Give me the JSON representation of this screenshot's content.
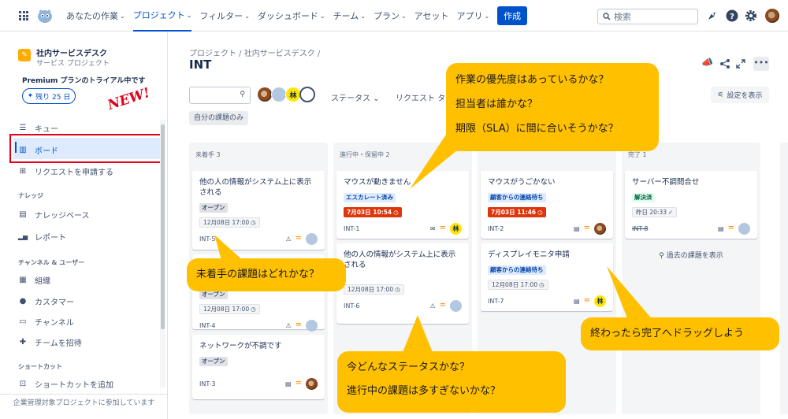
{
  "topbar": {
    "nav": [
      {
        "label": "あなたの作業",
        "chev": true,
        "active": false
      },
      {
        "label": "プロジェクト",
        "chev": true,
        "active": true
      },
      {
        "label": "フィルター",
        "chev": true,
        "active": false
      },
      {
        "label": "ダッシュボード",
        "chev": true,
        "active": false
      },
      {
        "label": "チーム",
        "chev": true,
        "active": false
      },
      {
        "label": "プラン",
        "chev": true,
        "active": false
      },
      {
        "label": "アセット",
        "chev": false,
        "active": false
      },
      {
        "label": "アプリ",
        "chev": true,
        "active": false
      }
    ],
    "create_label": "作成",
    "search_placeholder": "検索"
  },
  "sidebar": {
    "project_name": "社内サービスデスク",
    "project_type": "サービス プロジェクト",
    "premium_text": "Premium プランのトライアル中です",
    "trial_label": "残り 25 日",
    "new_label": "NEW!",
    "items_main": [
      {
        "label": "キュー",
        "icon": "queue-icon",
        "glyph": "☰"
      },
      {
        "label": "ボード",
        "icon": "board-icon",
        "glyph": "▥"
      },
      {
        "label": "リクエストを申請する",
        "icon": "request-icon",
        "glyph": "⊞"
      }
    ],
    "section_knowledge": "ナレッジ",
    "items_knowledge": [
      {
        "label": "ナレッジベース",
        "icon": "knowledge-base-icon",
        "glyph": "▤"
      },
      {
        "label": "レポート",
        "icon": "report-icon",
        "glyph": "▁▃▅"
      }
    ],
    "section_channels": "チャンネル & ユーザー",
    "items_channels": [
      {
        "label": "組織",
        "icon": "organization-icon",
        "glyph": "▦"
      },
      {
        "label": "カスタマー",
        "icon": "customers-icon",
        "glyph": "●"
      },
      {
        "label": "チャンネル",
        "icon": "channel-icon",
        "glyph": "▭"
      },
      {
        "label": "チームを招待",
        "icon": "invite-team-icon",
        "glyph": "+"
      }
    ],
    "section_shortcuts": "ショートカット",
    "add_shortcut": "ショートカットを追加",
    "footer": "企業管理対象プロジェクトに参加しています"
  },
  "header": {
    "breadcrumb": "プロジェクト  /  社内サービスデスク  /",
    "title": "INT",
    "filters": {
      "avatar_letter": "林",
      "status_label": "ステータス",
      "request_label": "リクエスト タイ",
      "my_issues_label": "自分の課題のみ",
      "settings_label": "設定を表示"
    }
  },
  "columns": [
    {
      "title": "未着手 3"
    },
    {
      "title": "進行中・保留中 2"
    },
    {
      "title": ""
    },
    {
      "title": "完了 1"
    }
  ],
  "cards": {
    "c1": {
      "title": "他の人の情報がシステム上に表示される",
      "status": "オープン",
      "due": "12月08日 17:00",
      "key": "INT-5"
    },
    "c2": {
      "status": "オープン",
      "due": "12月08日 17:00",
      "key": "INT-4"
    },
    "c3": {
      "title": "ネットワークが不調です",
      "status": "オープン",
      "key": "INT-3"
    },
    "c4": {
      "title": "マウスが動きません",
      "status": "エスカレート済み",
      "due": "7月03日 10:54",
      "key": "INT-1",
      "avatar_letter": "林"
    },
    "c5": {
      "title": "他の人の情報がシステム上に表示される",
      "due": "12月08日 17:00",
      "key": "INT-6"
    },
    "c6": {
      "title": "マウスがうごかない",
      "status": "顧客からの連絡待ち",
      "due": "7月03日 11:46",
      "key": "INT-2"
    },
    "c7": {
      "title": "ディスプレイモニタ申請",
      "status": "顧客からの連絡待ち",
      "due": "12月08日 17:00",
      "key": "INT-7",
      "avatar_letter": "林"
    },
    "c8": {
      "title": "サーバー不調問合せ",
      "status": "解決済",
      "due": "昨日 20:33",
      "key": "INT-8"
    }
  },
  "show_past": "過去の課題を表示",
  "callouts": {
    "top": [
      "作業の優先度はあっているかな？",
      "担当者は誰かな？",
      "期限（SLA）に間に合いそうかな？"
    ],
    "todo": "未着手の課題はどれかな？",
    "status": [
      "今どんなステータスかな？",
      "進行中の課題は多すぎないかな？"
    ],
    "done": "終わったら完了へドラッグしよう"
  },
  "colors": {
    "accent": "#0052cc",
    "callout": "#ffc000",
    "highlight": "#e3001b",
    "overdue": "#de350b"
  }
}
